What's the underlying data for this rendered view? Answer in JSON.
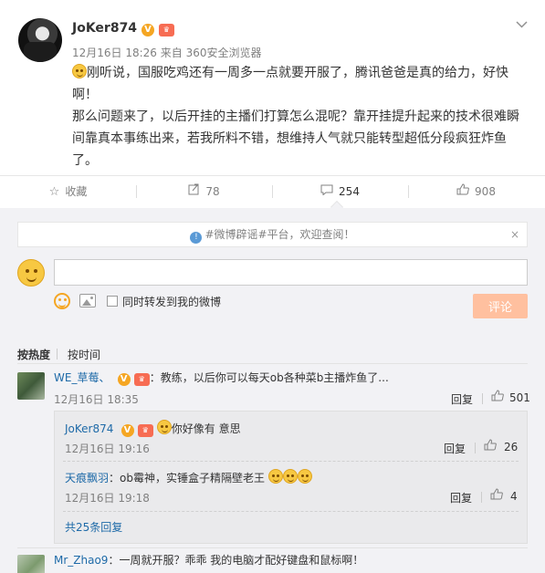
{
  "post": {
    "username": "JoKer874",
    "verified_badge": "V",
    "level_badge": "Lv",
    "timestamp": "12月16日 18:26",
    "source_prefix": "来自",
    "source": "360安全浏览器",
    "more_icon": "chevron-down-icon",
    "text_line1": "刚听说，国服吃鸡还有一周多一点就要开服了，腾讯爸爸是真的给力，好快",
    "text_line2": "啊！",
    "text_line3": "那么问题来了，以后开挂的主播们打算怎么混呢？靠开挂提升起来的技术很难瞬",
    "text_line4": "间靠真本事练出来，若我所料不错，想维持人气就只能转型超低分段疯狂炸鱼",
    "text_line5": "了。"
  },
  "actions": {
    "favorite_label": "收藏",
    "forward_count": "78",
    "comment_count": "254",
    "like_count": "908"
  },
  "comment_box": {
    "notice": "#微博辟谣#平台，欢迎查阅！",
    "notice_close": "×",
    "input_value": "",
    "forward_label": "同时转发到我的微博",
    "submit_label": "评论"
  },
  "sort": {
    "by_hot": "按热度",
    "by_time": "按时间"
  },
  "comments": [
    {
      "name": "WE_草莓、",
      "text": "：教练，以后你可以每天ob各种菜b主播炸鱼了...",
      "time": "12月16日 18:35",
      "reply_label": "回复",
      "likes": "501"
    },
    {
      "name": "Mr_Zhao9",
      "text": "：一周就开服？乖乖  我的电脑才配好键盘和鼠标啊！"
    }
  ],
  "replies": [
    {
      "name": "JoKer874",
      "text": "你好像有 意思",
      "time": "12月16日 19:16",
      "reply_label": "回复",
      "likes": "26"
    },
    {
      "name": "天痕飘羽",
      "text": "：ob霉神，实锤盒子精隔壁老王",
      "time": "12月16日 19:18",
      "reply_label": "回复",
      "likes": "4"
    }
  ],
  "more_replies": "共25条回复"
}
